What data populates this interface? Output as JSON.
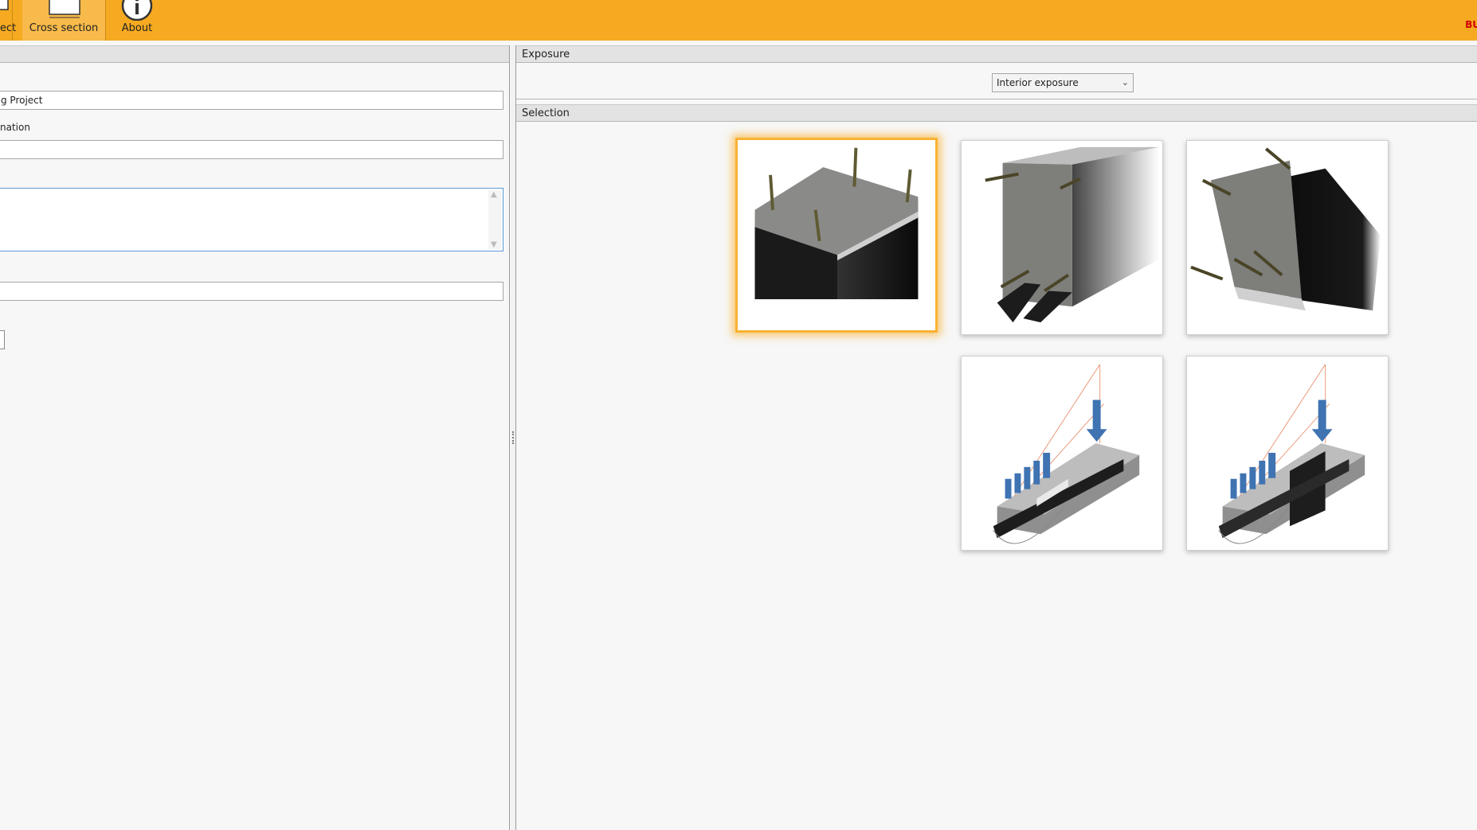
{
  "ribbon": {
    "project_label": "ect",
    "cross_section_label": "Cross section",
    "about_label": "About",
    "corner_text": "BU"
  },
  "left_panel": {
    "project_name_value": "g Project",
    "designation_label": "nation"
  },
  "exposure": {
    "header": "Exposure",
    "selected": "Interior exposure"
  },
  "selection": {
    "header": "Selection",
    "tiles": [
      {
        "name": "column-four-sides",
        "selected": true
      },
      {
        "name": "beam-three-sides",
        "selected": false
      },
      {
        "name": "beam-corner",
        "selected": false
      },
      {
        "name": "beam-bending-diagram-1",
        "selected": false
      },
      {
        "name": "beam-bending-diagram-2",
        "selected": false
      }
    ]
  },
  "colors": {
    "ribbon": "#f6aa21",
    "selection_glow": "#f9b233",
    "focus_border": "#5b9bd5"
  }
}
